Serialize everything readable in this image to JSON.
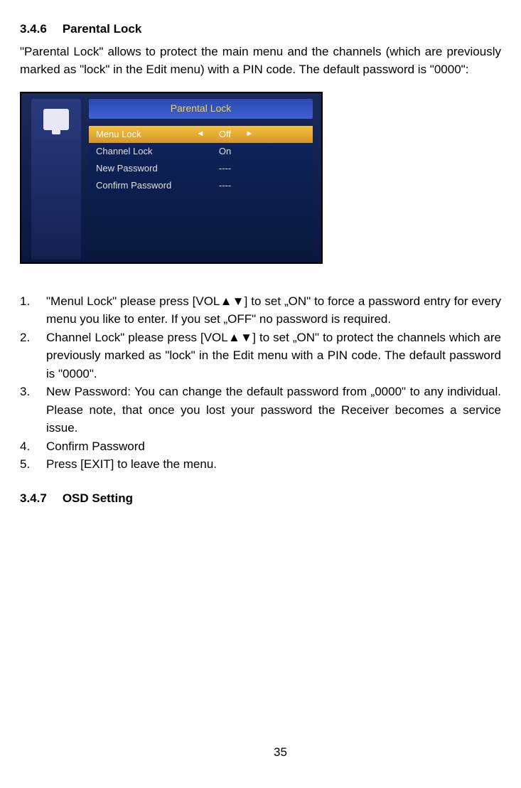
{
  "section1": {
    "number": "3.4.6",
    "title": "Parental  Lock",
    "intro": "\"Parental Lock\" allows to protect the main menu and the channels (which are previously marked as \"lock\" in the Edit menu) with a PIN code. The default password is \"0000\":"
  },
  "screenshot": {
    "title": "Parental Lock",
    "rows": [
      {
        "label": "Menu Lock",
        "value": "Off",
        "selected": true,
        "arrows": true
      },
      {
        "label": "Channel Lock",
        "value": "On",
        "selected": false,
        "arrows": false
      },
      {
        "label": "New Password",
        "value": "----",
        "selected": false,
        "arrows": false
      },
      {
        "label": "Confirm Password",
        "value": "----",
        "selected": false,
        "arrows": false
      }
    ]
  },
  "steps": [
    "\"Menul Lock\" please press [VOL▲▼] to set „ON\" to force a password entry for every menu you like to enter. If you set „OFF\" no password is required.",
    "Channel Lock\" please press [VOL▲▼] to set „ON\" to protect the channels which are previously marked as \"lock\" in the Edit menu with a PIN code. The default password is \"0000\".",
    "New Password: You can change the default password from „0000\" to any individual. Please note, that once you lost your password the Receiver becomes a service issue.",
    "Confirm Password",
    "Press [EXIT] to leave the menu."
  ],
  "section2": {
    "number": "3.4.7",
    "title": "OSD  Setting"
  },
  "pageNumber": "35"
}
